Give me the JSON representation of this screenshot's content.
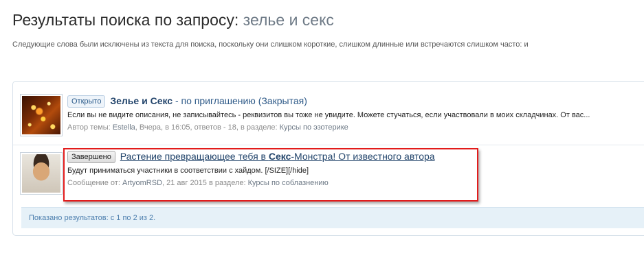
{
  "page": {
    "title_prefix": "Результаты поиска по запросу:",
    "query": "зелье и секс",
    "excluded_note": "Следующие слова были исключены из текста для поиска, поскольку они слишком короткие, слишком длинные или встречаются слишком часто: и"
  },
  "results": [
    {
      "badge": "Открыто",
      "title_bold": "Зелье и Секс",
      "title_rest": " - по приглашению (Закрытая)",
      "snippet": "Если вы не видите описания, не записывайтесь - реквизитов вы тоже не увидите. Можете стучаться, если участвовали в моих складчинах. От вас...",
      "meta_prefix": "Автор темы: ",
      "author": "Estella",
      "meta_mid": ", Вчера, в 16:05, ответов - 18, в разделе: ",
      "category": "Курсы по эзотерике",
      "avatar_icon": "starry-avatar"
    },
    {
      "badge": "Завершено",
      "title_a": "Растение превращающее тебя в ",
      "title_bold": "Секс",
      "title_b": "-Монстра! От известного автора",
      "snippet": "Будут приниматься участники в соответствии с хайдом. [/SIZE][/hide]",
      "meta_prefix": "Сообщение от: ",
      "author": "ArtyomRSD",
      "meta_mid": ", 21 авг 2015 в разделе: ",
      "category": "Курсы по соблазнению",
      "avatar_icon": "person-avatar"
    }
  ],
  "footer": {
    "summary": "Показано результатов: с 1 по 2 из 2."
  },
  "colors": {
    "highlight_border": "#e21b1b",
    "link": "#22446b",
    "footer_bg": "#e6f1f8"
  }
}
